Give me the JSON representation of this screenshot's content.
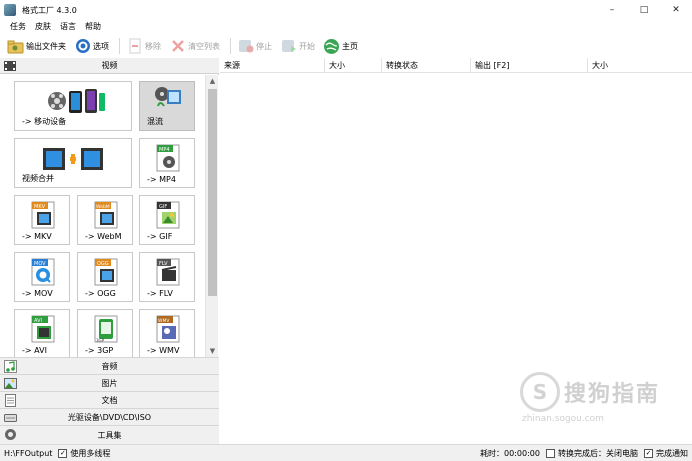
{
  "window": {
    "title": "格式工厂 4.3.0",
    "controls": [
      "–",
      "□",
      "✕"
    ]
  },
  "menu": [
    "任务",
    "皮肤",
    "语言",
    "帮助"
  ],
  "toolbar": {
    "output_folder": "输出文件夹",
    "options": "选项",
    "remove": "移除",
    "clear_list": "清空列表",
    "stop": "停止",
    "start": "开始",
    "home": "主页"
  },
  "left": {
    "video_header": "视频",
    "tiles": [
      {
        "label": "-> 移动设备",
        "icon": "mobile-device-icon"
      },
      {
        "label": "混流",
        "icon": "mux-icon"
      },
      {
        "label": "视频合并",
        "icon": "video-join-icon"
      },
      {
        "label": "-> MP4",
        "icon": "mp4-file-icon",
        "badge": "MP4"
      },
      {
        "label": "-> MKV",
        "icon": "mkv-file-icon",
        "badge": "MKV"
      },
      {
        "label": "-> WebM",
        "icon": "webm-file-icon",
        "badge": "WebM"
      },
      {
        "label": "-> GIF",
        "icon": "gif-file-icon",
        "badge": "GIF"
      },
      {
        "label": "-> MOV",
        "icon": "mov-file-icon",
        "badge": "MOV"
      },
      {
        "label": "-> OGG",
        "icon": "ogg-file-icon",
        "badge": "OGG"
      },
      {
        "label": "-> FLV",
        "icon": "flv-file-icon",
        "badge": "FLV"
      },
      {
        "label": "-> AVI",
        "icon": "avi-file-icon",
        "badge": "AVI"
      },
      {
        "label": "-> 3GP",
        "icon": "3gp-file-icon",
        "badge": "3GP"
      },
      {
        "label": "-> WMV",
        "icon": "wmv-file-icon",
        "badge": "WMV"
      }
    ],
    "categories": {
      "audio": "音频",
      "picture": "图片",
      "document": "文档",
      "disc": "光驱设备\\DVD\\CD\\ISO",
      "toolbox": "工具集"
    }
  },
  "list": {
    "columns": [
      "来源",
      "大小",
      "转换状态",
      "输出 [F2]",
      "大小"
    ]
  },
  "watermark": {
    "logo_char": "S",
    "title": "搜狗指南",
    "url": "zhinan.sogou.com"
  },
  "status": {
    "output_path": "H:\\FFOutput",
    "multithread": "使用多线程",
    "elapsed": "耗时：00:00:00",
    "after_done": "转换完成后：关闭电脑",
    "notify": "完成通知"
  },
  "colors": {
    "accent_green": "#2e9e3e",
    "selected_tile": "#d9d9d9",
    "panel_bg": "#f0f0f0"
  }
}
